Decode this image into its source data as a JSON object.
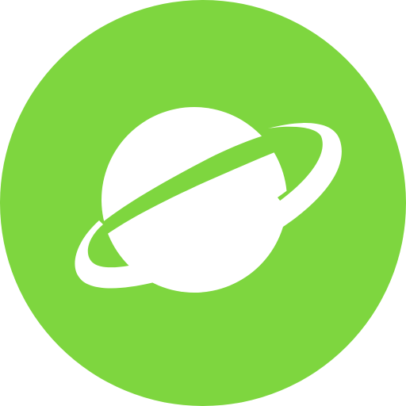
{
  "icon": {
    "name": "planet-icon",
    "background_color": "#7ED63F",
    "foreground_color": "#FFFFFF"
  }
}
